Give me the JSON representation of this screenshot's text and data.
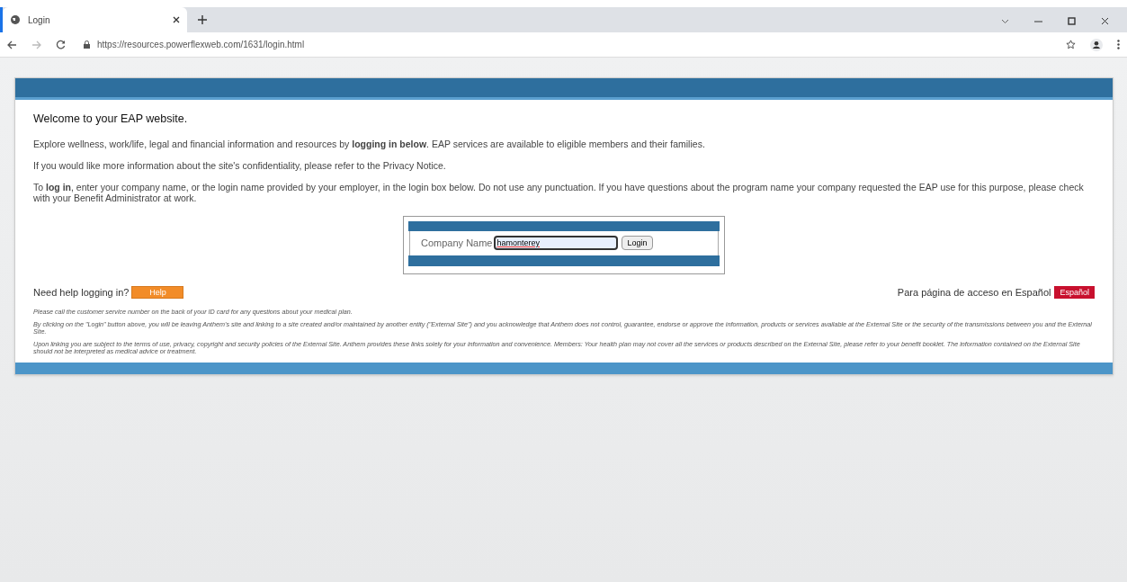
{
  "browser": {
    "tab_title": "Login",
    "url": "https://resources.powerflexweb.com/1631/login.html"
  },
  "page": {
    "heading": "Welcome to your EAP website.",
    "paragraphs": [
      "Explore wellness, work/life, legal and financial information and resources by **logging in below**. EAP services are available to eligible members and their families.",
      "If you would like more information about the site's confidentiality, please refer to the Privacy Notice.",
      "To **log in**, enter your company name, or the login name provided by your employer, in the login box below. Do not use any punctuation. If you have questions about the program name your company requested the EAP use for this purpose, please check with your Benefit Administrator at work."
    ],
    "login": {
      "label": "Company Name",
      "value": "hamonterey",
      "button": "Login"
    },
    "help": {
      "text": "Need help logging in?",
      "button": "Help"
    },
    "spanish": {
      "text": "Para página de acceso en Español",
      "button": "Español"
    },
    "disclaimers": [
      "Please call the customer service number on the back of your ID card for any questions about your medical plan.",
      "By clicking on the \"Login\" button above, you will be leaving Anthem's site and linking to a site created and/or maintained by another entity (\"External Site\") and you acknowledge that Anthem does not control, guarantee, endorse or approve the information, products or services available at the External Site or the security of the transmissions between you and the External Site.",
      "Upon linking you are subject to the terms of use, privacy, copyright and security policies of the External Site. Anthem provides these links solely for your information and convenience. Members: Your health plan may not cover all the services or products described on the External Site, please refer to your benefit booklet. The information contained on the External Site should not be interpreted as medical advice or treatment."
    ]
  }
}
